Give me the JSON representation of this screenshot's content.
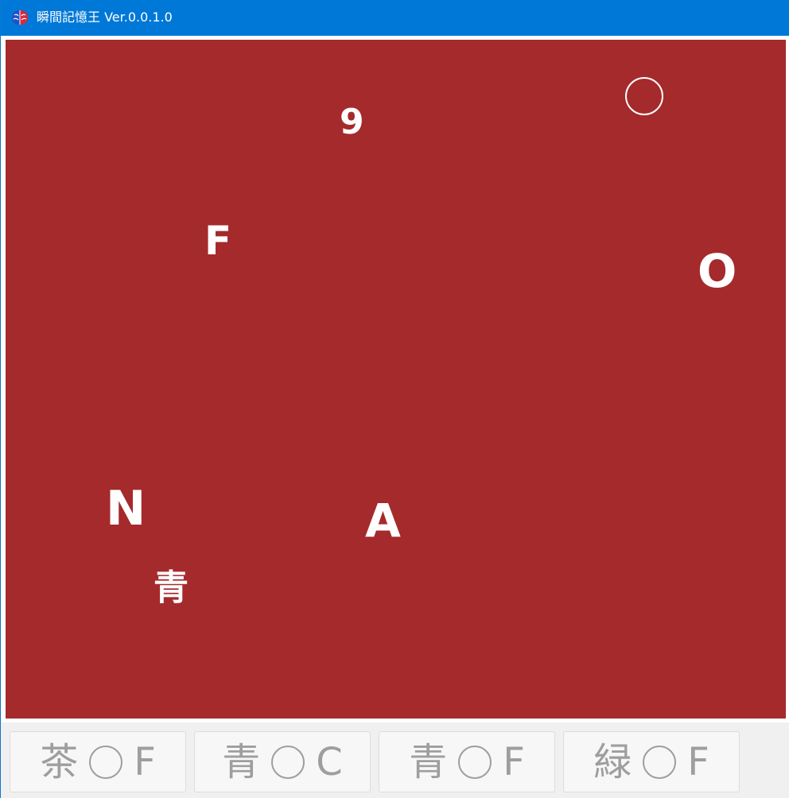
{
  "window": {
    "title": "瞬間記憶王 Ver.0.0.1.0",
    "accent_color": "#0078d7",
    "icon": "brain-icon"
  },
  "canvas": {
    "background_color": "#a52a2c",
    "symbols": [
      {
        "text": "9",
        "kind": "digit"
      },
      {
        "text": "F",
        "kind": "letter"
      },
      {
        "text": "O",
        "kind": "letter"
      },
      {
        "text": "N",
        "kind": "letter"
      },
      {
        "text": "A",
        "kind": "letter"
      },
      {
        "text": "青",
        "kind": "kanji"
      }
    ],
    "circle_symbol": "circle-shape"
  },
  "answers": [
    {
      "color_word": "茶",
      "shape": "circle-shape",
      "letter": "F"
    },
    {
      "color_word": "青",
      "shape": "circle-shape",
      "letter": "C"
    },
    {
      "color_word": "青",
      "shape": "circle-shape",
      "letter": "F"
    },
    {
      "color_word": "緑",
      "shape": "circle-shape",
      "letter": "F"
    }
  ]
}
